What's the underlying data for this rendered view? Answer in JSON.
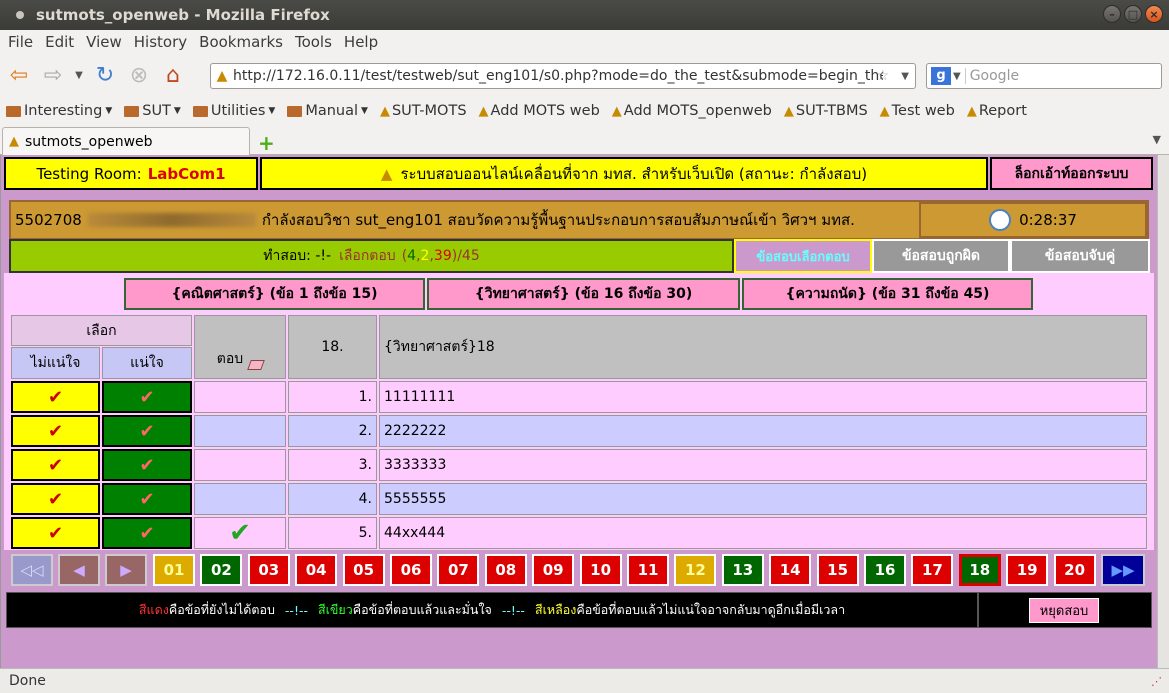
{
  "window": {
    "title": "sutmots_openweb - Mozilla Firefox"
  },
  "menu": [
    "File",
    "Edit",
    "View",
    "History",
    "Bookmarks",
    "Tools",
    "Help"
  ],
  "url": "http://172.16.0.11/test/testweb/sut_eng101/s0.php?mode=do_the_test&submode=begin_the_",
  "search_placeholder": "Google",
  "bookmarks": [
    {
      "label": "Interesting",
      "type": "folder"
    },
    {
      "label": "SUT",
      "type": "folder"
    },
    {
      "label": "Utilities",
      "type": "folder"
    },
    {
      "label": "Manual",
      "type": "folder"
    },
    {
      "label": "SUT-MOTS",
      "type": "link"
    },
    {
      "label": "Add MOTS web",
      "type": "link"
    },
    {
      "label": "Add MOTS_openweb",
      "type": "link"
    },
    {
      "label": "SUT-TBMS",
      "type": "link"
    },
    {
      "label": "Test web",
      "type": "link"
    },
    {
      "label": "Report",
      "type": "link"
    }
  ],
  "tab": {
    "label": "sutmots_openweb"
  },
  "header": {
    "room_label": "Testing Room:",
    "room_value": "LabCom1",
    "system_title": "ระบบสอบออนไลน์เคลื่อนที่จาก มทส. สำหรับเว็บเปิด (สถานะ: กำลังสอบ)",
    "logout": "ล็อกเอ้าท์ออกระบบ"
  },
  "student": {
    "id": "5502708",
    "text": "กำลังสอบวิชา sut_eng101 สอบวัดความรู้พื้นฐานประกอบการสอบสัมภาษณ์เข้า วิศวฯ มทส.",
    "timer": "0:28:37"
  },
  "progress": {
    "prefix": "ทำสอบ: -!-",
    "label": "เลือกตอบ",
    "open": "(",
    "sure": "4",
    "c1": ",",
    "unsure": "2",
    "c2": ",",
    "unanswered": "39",
    "close": ")/45"
  },
  "mode_tabs": [
    "ข้อสอบเลือกตอบ",
    "ข้อสอบถูกผิด",
    "ข้อสอบจับคู่"
  ],
  "subjects": [
    "{คณิตศาสตร์} (ข้อ 1 ถึงข้อ 15)",
    "{วิทยาศาสตร์} (ข้อ 16 ถึงข้อ 30)",
    "{ความถนัด} (ข้อ 31 ถึงข้อ 45)"
  ],
  "question": {
    "select_header": "เลือก",
    "unsure_header": "ไม่แน่ใจ",
    "sure_header": "แน่ใจ",
    "answer_header": "ตอบ",
    "number": "18.",
    "text": "{วิทยาศาสตร์}18",
    "options": [
      {
        "no": "1.",
        "text": "11111111",
        "answered": false
      },
      {
        "no": "2.",
        "text": "2222222",
        "answered": false
      },
      {
        "no": "3.",
        "text": "3333333",
        "answered": false
      },
      {
        "no": "4.",
        "text": "5555555",
        "answered": false
      },
      {
        "no": "5.",
        "text": "44xx444",
        "answered": true
      }
    ]
  },
  "pages": [
    {
      "n": "01",
      "s": "yellow"
    },
    {
      "n": "02",
      "s": "green"
    },
    {
      "n": "03",
      "s": "red"
    },
    {
      "n": "04",
      "s": "red"
    },
    {
      "n": "05",
      "s": "red"
    },
    {
      "n": "06",
      "s": "red"
    },
    {
      "n": "07",
      "s": "red"
    },
    {
      "n": "08",
      "s": "red"
    },
    {
      "n": "09",
      "s": "red"
    },
    {
      "n": "10",
      "s": "red"
    },
    {
      "n": "11",
      "s": "red"
    },
    {
      "n": "12",
      "s": "yellow"
    },
    {
      "n": "13",
      "s": "green"
    },
    {
      "n": "14",
      "s": "red"
    },
    {
      "n": "15",
      "s": "red"
    },
    {
      "n": "16",
      "s": "green"
    },
    {
      "n": "17",
      "s": "red"
    },
    {
      "n": "18",
      "s": "current"
    },
    {
      "n": "19",
      "s": "red"
    },
    {
      "n": "20",
      "s": "red"
    }
  ],
  "legend": {
    "red_word": "สีแดง",
    "red_text": "คือข้อที่ยังไม่ได้ตอบ",
    "sep1": "--!--",
    "green_word": "สีเขียว",
    "green_text": "คือข้อที่ตอบแล้วและมั่นใจ",
    "sep2": "--!--",
    "yellow_word": "สีเหลือง",
    "yellow_text": "คือข้อที่ตอบแล้วไม่แน่ใจอาจกลับมาดูอีกเมื่อมีเวลา",
    "stop": "หยุดสอบ"
  },
  "status": "Done",
  "colors": {
    "red": "#dd0000",
    "green": "#006600",
    "yellow": "#ddaa00",
    "accent_pink": "#ff99cc"
  }
}
